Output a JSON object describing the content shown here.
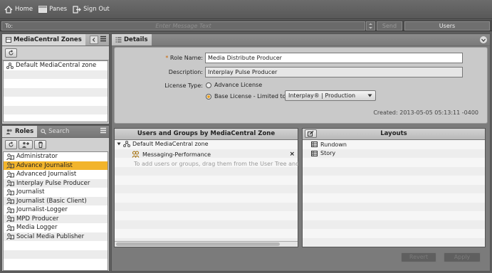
{
  "topbar": {
    "home_label": "Home",
    "panes_label": "Panes",
    "signout_label": "Sign Out"
  },
  "messagebar": {
    "to_label": "To:",
    "placeholder": "Enter Message Text",
    "send_label": "Send",
    "users_label": "Users"
  },
  "zones_panel": {
    "tab_label": "MediaCentral Zones",
    "items": [
      "Default MediaCentral zone"
    ]
  },
  "roles_panel": {
    "tab_roles": "Roles",
    "tab_search": "Search",
    "items": [
      "Administrator",
      "Advance Journalist",
      "Advanced Journalist",
      "Interplay Pulse Producer",
      "Journalist",
      "Journalist (Basic Client)",
      "Journalist-Logger",
      "MPD Producer",
      "Media Logger",
      "Social Media Publisher"
    ],
    "selected_index": 1
  },
  "details": {
    "tab_label": "Details",
    "role_name_label": "Role Name:",
    "role_name_value": "Media Distribute Producer",
    "description_label": "Description:",
    "description_value": "Interplay Pulse Producer",
    "license_type_label": "License Type:",
    "advance_license_label": "Advance License",
    "base_license_label": "Base License - Limited to:",
    "limited_to_value": "Interplay® | Production",
    "created_text": "Created: 2013-05-05 05:13:11 -0400"
  },
  "users_groups": {
    "header": "Users and Groups by MediaCentral Zone",
    "zone_label": "Default MediaCentral zone",
    "group_label": "Messaging-Performance",
    "hint": "To add users or groups, drag them from the User Tree and d"
  },
  "layouts": {
    "header": "Layouts",
    "items": [
      "Rundown",
      "Story"
    ]
  },
  "footer": {
    "revert_label": "Revert",
    "apply_label": "Apply"
  }
}
